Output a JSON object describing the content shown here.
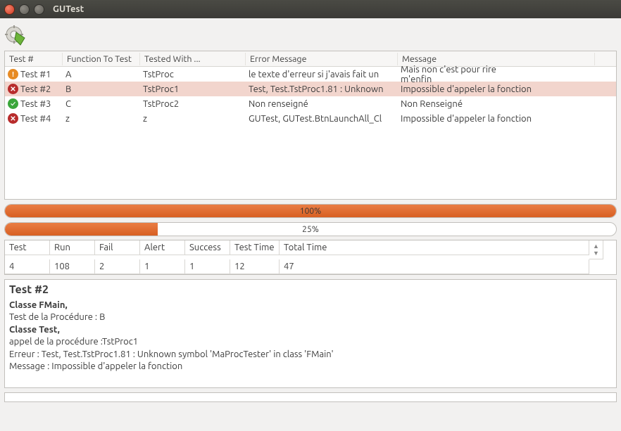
{
  "window": {
    "title": "GUTest"
  },
  "table": {
    "headers": [
      "Test #",
      "Function To Test",
      "Tested With ...",
      "Error Message",
      "Message"
    ],
    "rows": [
      {
        "status": "warn",
        "id": "Test #1",
        "fn": "A",
        "tested": "TstProc",
        "err": "le texte d'erreur si j'avais fait un",
        "msg": "Mais non c'est pour rire<BR>m'enfin",
        "selected": false
      },
      {
        "status": "error",
        "id": "Test #2",
        "fn": "B",
        "tested": "TstProc1",
        "err": "Test, Test.TstProc1.81 : Unknown",
        "msg": "Impossible d'appeler la fonction",
        "selected": true
      },
      {
        "status": "ok",
        "id": "Test #3",
        "fn": "C",
        "tested": "TstProc2",
        "err": "Non renseigné",
        "msg": "Non Renseigné",
        "selected": false
      },
      {
        "status": "error",
        "id": "Test #4",
        "fn": "z",
        "tested": "z",
        "err": "GUTest, GUTest.BtnLaunchAll_Cl",
        "msg": "Impossible d'appeler la fonction",
        "selected": false
      }
    ]
  },
  "progress": [
    {
      "percent": 100,
      "label": "100%"
    },
    {
      "percent": 25,
      "label": "25%"
    }
  ],
  "summary": {
    "headers": [
      "Test",
      "Run",
      "Fail",
      "Alert",
      "Success",
      "Test Time",
      "Total Time"
    ],
    "values": [
      "4",
      "108",
      "2",
      "1",
      "1",
      "12",
      "47"
    ]
  },
  "detail": {
    "title": "Test #2",
    "l1": "Classe FMain,",
    "l2": "Test de la Procédure : B",
    "l3": "Classe Test,",
    "l4": "appel de la procédure :TstProc1",
    "l5": "Erreur : Test, Test.TstProc1.81 : Unknown symbol 'MaProcTester' in class 'FMain'",
    "l6": "Message : Impossible d'appeler la fonction"
  },
  "status_glyph": {
    "warn": "!",
    "error": "✕",
    "ok": "✓"
  }
}
